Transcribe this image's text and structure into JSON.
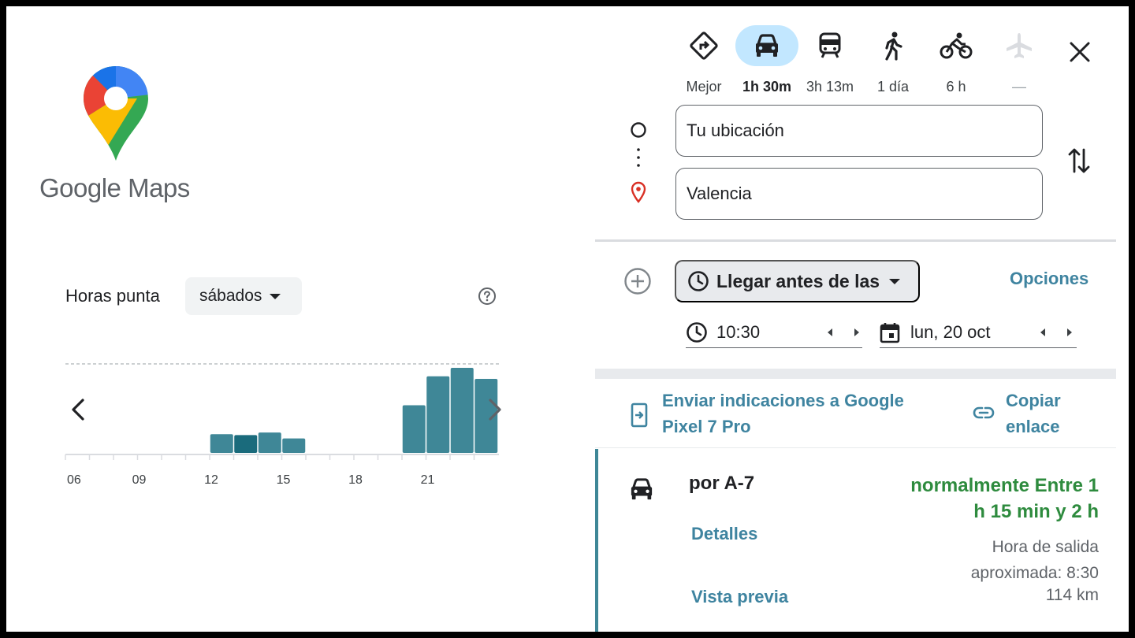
{
  "logo": {
    "text": "Google Maps"
  },
  "popular_times": {
    "title": "Horas punta",
    "day": "sábados",
    "tick_labels": [
      "06",
      "09",
      "12",
      "15",
      "18",
      "21"
    ],
    "bar_color": "#3f8797",
    "current_bar_color": "#1a6b7c"
  },
  "chart_data": {
    "type": "bar",
    "categories": [
      "06",
      "07",
      "08",
      "09",
      "10",
      "11",
      "12",
      "13",
      "14",
      "15",
      "16",
      "17",
      "18",
      "19",
      "20",
      "21",
      "22",
      "23"
    ],
    "values": [
      0,
      0,
      0,
      0,
      0,
      0,
      22,
      21,
      24,
      17,
      0,
      0,
      0,
      0,
      56,
      90,
      100,
      87
    ],
    "current_index": 7,
    "ylim": [
      0,
      100
    ],
    "grid": false
  },
  "modes": [
    {
      "name": "best",
      "label": "Mejor",
      "icon": "directions-icon"
    },
    {
      "name": "car",
      "label": "1h 30m",
      "icon": "car-icon",
      "active": true
    },
    {
      "name": "transit",
      "label": "3h 13m",
      "icon": "train-icon"
    },
    {
      "name": "walk",
      "label": "1 día",
      "icon": "walk-icon"
    },
    {
      "name": "bike",
      "label": "6 h",
      "icon": "bike-icon"
    },
    {
      "name": "flight",
      "label": "—",
      "icon": "plane-icon"
    }
  ],
  "origin": "Tu ubicación",
  "destination": "Valencia",
  "arrive": {
    "label": "Llegar antes de las"
  },
  "options_label": "Opciones",
  "time": "10:30",
  "date": "lun, 20 oct",
  "send": {
    "line1": "Enviar indicaciones a Google",
    "line2": "Pixel 7 Pro"
  },
  "copy": {
    "line1": "Copiar",
    "line2": "enlace"
  },
  "route": {
    "name": "por A-7",
    "details": "Detalles",
    "preview": "Vista previa",
    "duration_line1": "normalmente Entre 1",
    "duration_line2": "h 15 min y 2 h",
    "departure_line1": "Hora de salida",
    "departure_line2": "aproximada: 8:30",
    "distance": "114 km"
  },
  "colors": {
    "accent": "#3f84a0",
    "active_mode": "#c2e7ff",
    "duration": "#2e8b3e"
  }
}
